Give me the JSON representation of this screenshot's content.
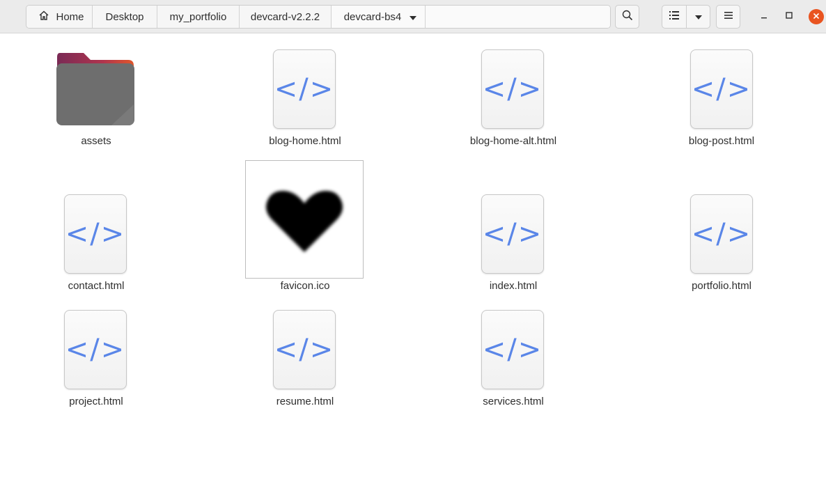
{
  "toolbar": {
    "breadcrumbs": [
      "Home",
      "Desktop",
      "my_portfolio",
      "devcard-v2.2.2",
      "devcard-bs4"
    ],
    "icons": {
      "home": "home-icon",
      "dropdown": "chevron-down-icon",
      "search": "search-icon",
      "view": "list-view-icon",
      "view_options": "chevron-down-icon",
      "menu": "hamburger-menu-icon",
      "minimize": "minimize-icon",
      "maximize": "maximize-icon",
      "close": "close-icon"
    }
  },
  "files": [
    {
      "name": "assets",
      "type": "folder"
    },
    {
      "name": "blog-home.html",
      "type": "html"
    },
    {
      "name": "blog-home-alt.html",
      "type": "html"
    },
    {
      "name": "blog-post.html",
      "type": "html"
    },
    {
      "name": "contact.html",
      "type": "html"
    },
    {
      "name": "favicon.ico",
      "type": "image"
    },
    {
      "name": "index.html",
      "type": "html"
    },
    {
      "name": "portfolio.html",
      "type": "html"
    },
    {
      "name": "project.html",
      "type": "html"
    },
    {
      "name": "resume.html",
      "type": "html"
    },
    {
      "name": "services.html",
      "type": "html"
    }
  ],
  "icon_glyph": "</>",
  "colors": {
    "accent_orange": "#e95420",
    "code_icon_blue": "#5a86e8",
    "folder_grey": "#6e6e6e",
    "folder_tab_purple": "#8c2d5c"
  }
}
